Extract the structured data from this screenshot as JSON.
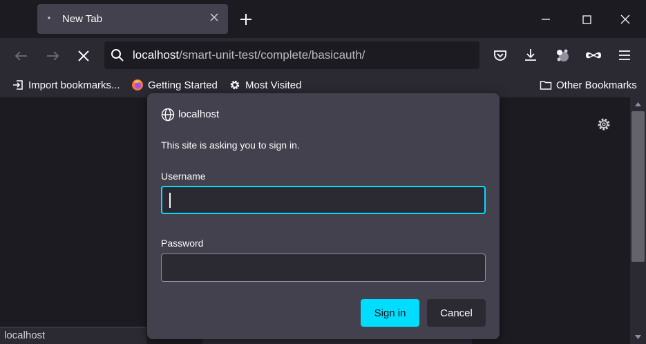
{
  "tab": {
    "title": "New Tab"
  },
  "urlbar": {
    "host": "localhost",
    "path": "/smart-unit-test/complete/basicauth/"
  },
  "bookmarks": {
    "items": [
      {
        "label": "Import bookmarks..."
      },
      {
        "label": "Getting Started"
      },
      {
        "label": "Most Visited"
      }
    ],
    "other_label": "Other Bookmarks"
  },
  "dialog": {
    "host": "localhost",
    "message": "This site is asking you to sign in.",
    "username_label": "Username",
    "username_value": "",
    "password_label": "Password",
    "password_value": "",
    "sign_in_label": "Sign in",
    "cancel_label": "Cancel"
  },
  "status": {
    "text": "localhost"
  },
  "colors": {
    "accent": "#00ddff",
    "dialog_bg": "#42414d",
    "toolbar_bg": "#2b2a33",
    "window_bg": "#1c1b22"
  }
}
